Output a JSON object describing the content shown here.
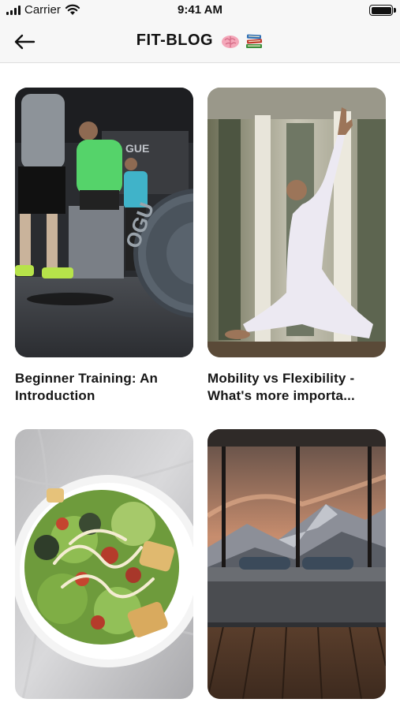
{
  "status_bar": {
    "carrier": "Carrier",
    "time": "9:41 AM"
  },
  "nav": {
    "title": "FIT-BLOG",
    "title_icons": [
      "brain-emoji-icon",
      "books-emoji-icon"
    ],
    "back_icon": "arrow-left-icon"
  },
  "posts": [
    {
      "title": "Beginner Training: An\nIntroduction",
      "image": "gym-weight-plate-photo"
    },
    {
      "title": "Mobility vs Flexibility -\nWhat's more importa...",
      "image": "yoga-stretch-photo"
    },
    {
      "title": "",
      "image": "salad-plate-photo"
    },
    {
      "title": "",
      "image": "bed-mountain-view-photo"
    }
  ]
}
